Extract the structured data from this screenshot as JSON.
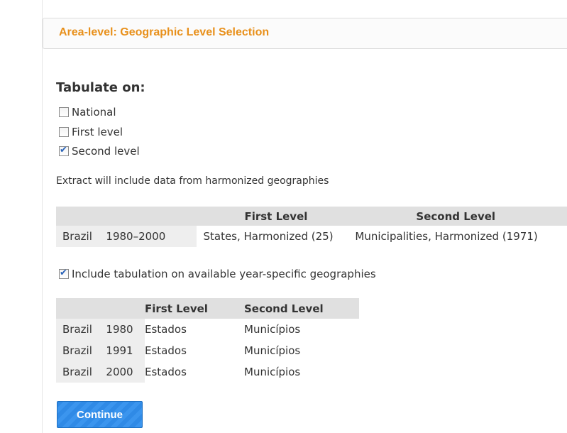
{
  "header": {
    "title": "Area-level: Geographic Level Selection"
  },
  "tabulate": {
    "heading": "Tabulate on:",
    "options": [
      {
        "label": "National",
        "checked": false
      },
      {
        "label": "First level",
        "checked": false
      },
      {
        "label": "Second level",
        "checked": true
      }
    ]
  },
  "harmonized": {
    "note": "Extract will include data from harmonized geographies",
    "headers": [
      "First Level",
      "Second Level"
    ],
    "rows": [
      {
        "country": "Brazil",
        "years": "1980–2000",
        "first": "States, Harmonized  (25)",
        "second": "Municipalities, Harmonized  (1971)"
      }
    ]
  },
  "year_specific": {
    "include_label": "Include tabulation on available year-specific geographies",
    "include_checked": true,
    "headers": [
      "First Level",
      "Second Level"
    ],
    "rows": [
      {
        "country": "Brazil",
        "year": "1980",
        "first": "Estados",
        "second": "Municípios"
      },
      {
        "country": "Brazil",
        "year": "1991",
        "first": "Estados",
        "second": "Municípios"
      },
      {
        "country": "Brazil",
        "year": "2000",
        "first": "Estados",
        "second": "Municípios"
      }
    ]
  },
  "actions": {
    "continue_label": "Continue"
  }
}
